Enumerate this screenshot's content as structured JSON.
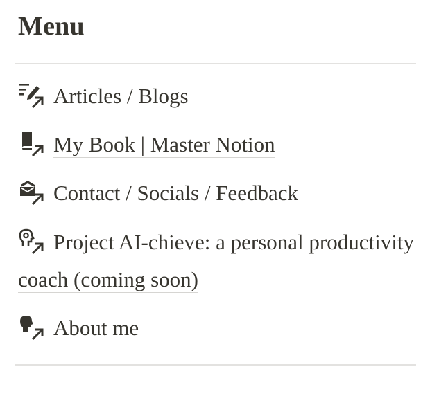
{
  "menu": {
    "title": "Menu",
    "items": [
      {
        "label": "Articles / Blogs",
        "icon": "articles-edit-icon"
      },
      {
        "label": "My Book | Master Notion",
        "icon": "book-icon"
      },
      {
        "label": "Contact / Socials / Feedback",
        "icon": "contact-mail-icon"
      },
      {
        "label": "Project AI-chieve: a personal productivity coach (coming soon)",
        "icon": "ai-head-icon"
      },
      {
        "label": "About me",
        "icon": "person-icon"
      }
    ]
  },
  "colors": {
    "text": "#37352f",
    "divider": "#e3e2e0",
    "underline": "#d6d5d2"
  }
}
